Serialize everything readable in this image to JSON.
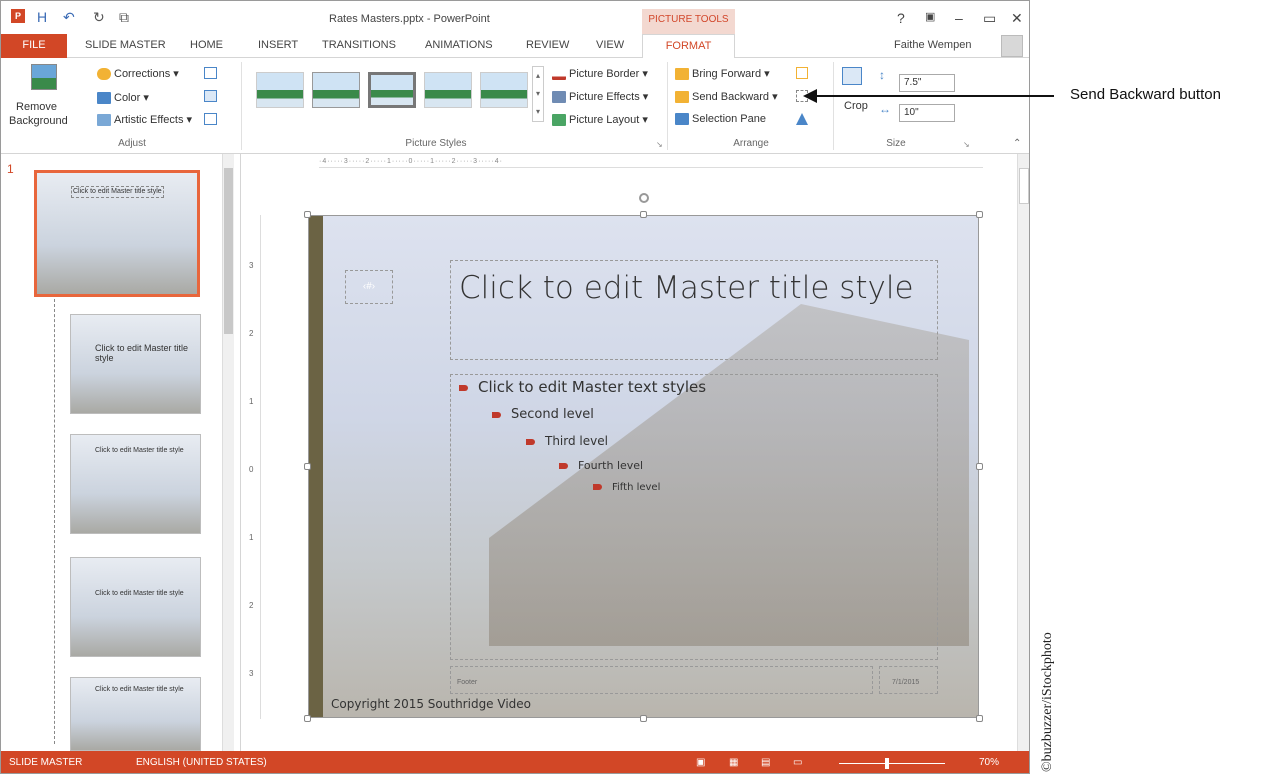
{
  "window": {
    "title": "Rates Masters.pptx - PowerPoint",
    "context_tab": "PICTURE TOOLS",
    "user": "Faithe Wempen",
    "controls": [
      "?",
      "▣",
      "–",
      "▭",
      "✕"
    ]
  },
  "quick_access": [
    "P",
    "H",
    "↶",
    "↻",
    "⧉"
  ],
  "tabs": [
    "FILE",
    "SLIDE MASTER",
    "HOME",
    "INSERT",
    "TRANSITIONS",
    "ANIMATIONS",
    "REVIEW",
    "VIEW",
    "FORMAT"
  ],
  "ribbon": {
    "remove_bg": "Remove Background",
    "corrections": "Corrections",
    "color": "Color",
    "artistic": "Artistic Effects",
    "adjust_label": "Adjust",
    "picture_border": "Picture Border",
    "picture_effects": "Picture Effects",
    "picture_layout": "Picture Layout",
    "styles_label": "Picture Styles",
    "bring_forward": "Bring Forward",
    "send_backward": "Send Backward",
    "selection_pane": "Selection Pane",
    "arrange_label": "Arrange",
    "crop": "Crop",
    "height": "7.5\"",
    "width": "10\"",
    "size_label": "Size"
  },
  "thumbnails": {
    "number": "1",
    "t1_title": "Click to edit Master title style",
    "t2_title": "Click to edit Master title style",
    "t3_title": "Click to edit Master title style",
    "t4_title": "Click to edit Master title style",
    "t5_title": "Click to edit Master title style"
  },
  "ruler": {
    "h_marks": "·4·····3·····2·····1·····0·····1·····2·····3·····4·",
    "v_marks": [
      "3",
      "2",
      "1",
      "0",
      "1",
      "2",
      "3"
    ]
  },
  "slide": {
    "slide_num": "‹#›",
    "title": "Click to edit Master title style",
    "levels": [
      "Click to edit Master text styles",
      "Second level",
      "Third level",
      "Fourth level",
      "Fifth level"
    ],
    "footer": "Footer",
    "date": "7/1/2015",
    "copyright": "Copyright 2015 Southridge Video"
  },
  "status": {
    "view": "SLIDE MASTER",
    "lang": "ENGLISH (UNITED STATES)",
    "zoom": "70%"
  },
  "callout": "Send Backward button",
  "credit": "©buzbuzzer/iStockphoto",
  "colors": {
    "accent": "#d24726",
    "bullet": "#c0392b",
    "slide_bar": "#6b6344"
  }
}
